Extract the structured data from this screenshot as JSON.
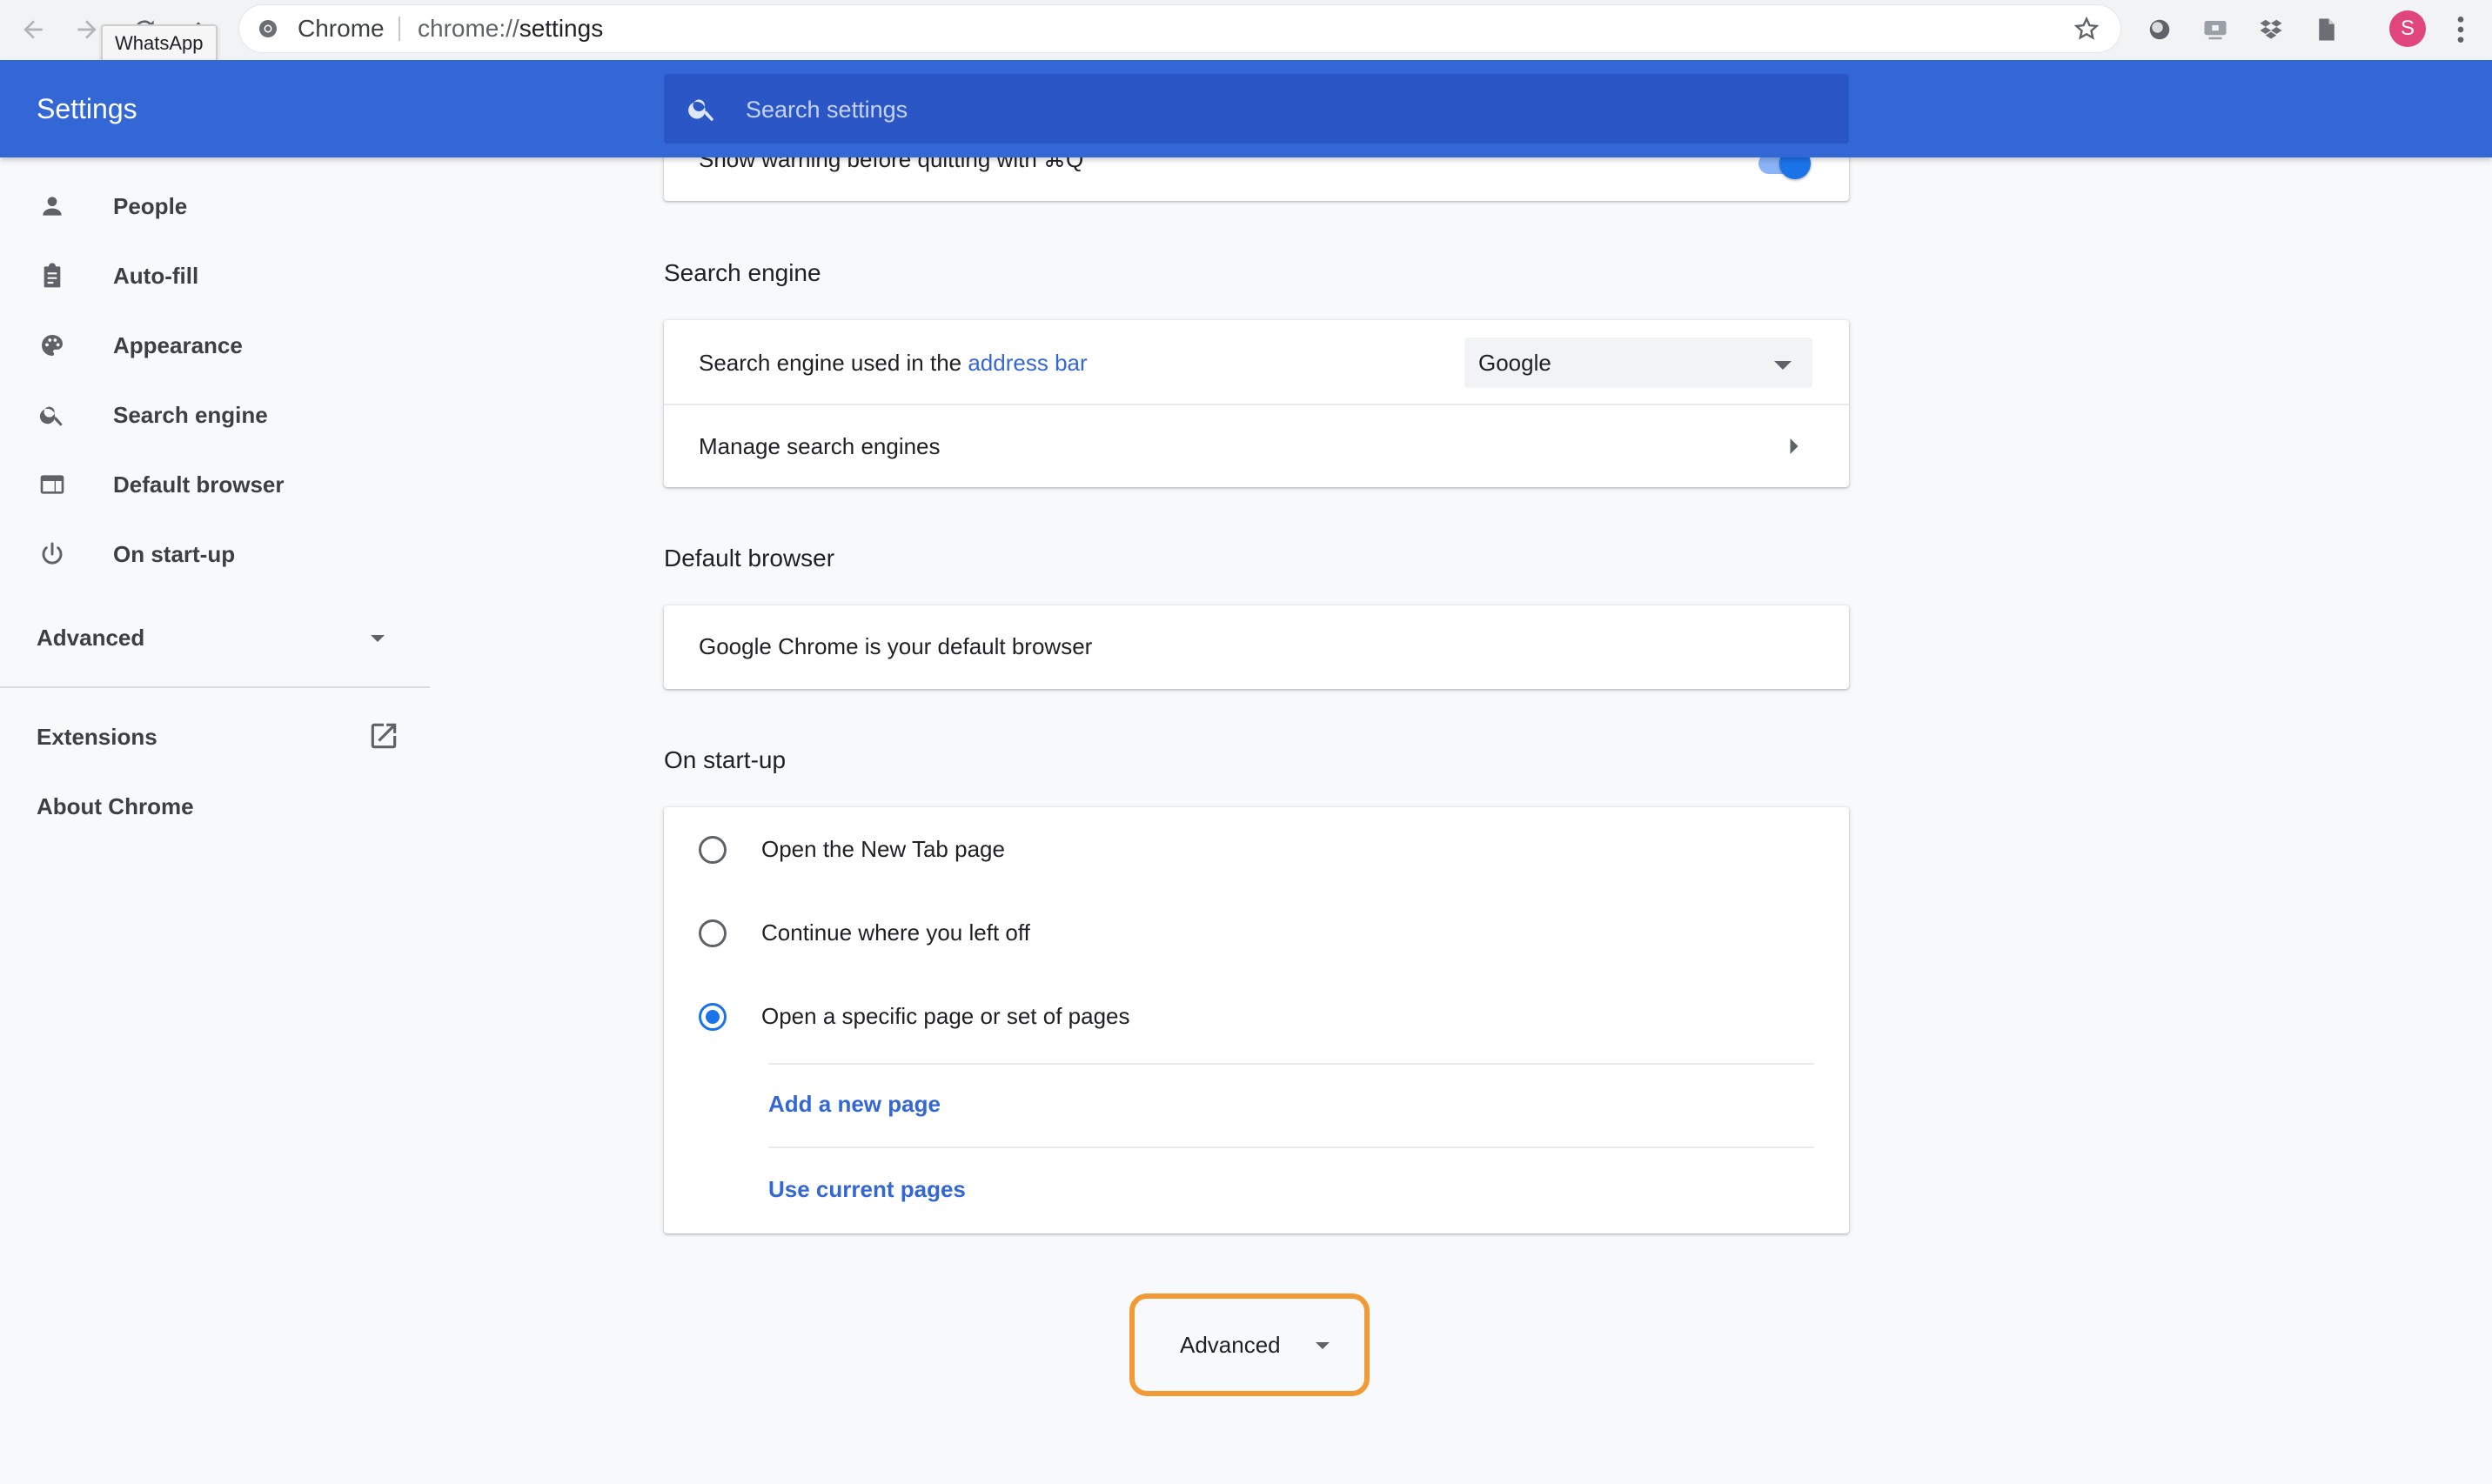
{
  "browser": {
    "tooltip": "WhatsApp",
    "site_chip": "Chrome",
    "url_prefix": "chrome://",
    "url_host": "settings",
    "avatar_letter": "S",
    "icons": [
      "back-arrow-icon",
      "forward-arrow-icon",
      "reload-icon",
      "apps-icon",
      "chrome-logo-icon",
      "star-icon",
      "extension-icon",
      "cast-icon",
      "dropbox-icon",
      "document-icon",
      "more-vert-icon"
    ]
  },
  "header": {
    "title": "Settings",
    "search_placeholder": "Search settings"
  },
  "sidebar": {
    "items": [
      {
        "label": "People",
        "icon": "person-icon"
      },
      {
        "label": "Auto-fill",
        "icon": "clipboard-icon"
      },
      {
        "label": "Appearance",
        "icon": "palette-icon"
      },
      {
        "label": "Search engine",
        "icon": "search-icon"
      },
      {
        "label": "Default browser",
        "icon": "browser-window-icon"
      },
      {
        "label": "On start-up",
        "icon": "power-icon"
      }
    ],
    "advanced_label": "Advanced",
    "extensions_label": "Extensions",
    "about_label": "About Chrome"
  },
  "main": {
    "partial_row_label": "Show warning before quitting with ⌘Q",
    "search_engine": {
      "title": "Search engine",
      "used_prefix": "Search engine used in the ",
      "used_link": "address bar",
      "selected": "Google",
      "manage_label": "Manage search engines"
    },
    "default_browser": {
      "title": "Default browser",
      "status": "Google Chrome is your default browser"
    },
    "startup": {
      "title": "On start-up",
      "options": [
        {
          "label": "Open the New Tab page",
          "selected": false
        },
        {
          "label": "Continue where you left off",
          "selected": false
        },
        {
          "label": "Open a specific page or set of pages",
          "selected": true
        }
      ],
      "add_page": "Add a new page",
      "use_current": "Use current pages"
    },
    "advanced_button": "Advanced"
  },
  "colors": {
    "header_blue": "#3367d6",
    "search_blue": "#2a56c6",
    "link_blue": "#3367d6",
    "highlight_orange": "#f29a36",
    "avatar_pink": "#e0457b"
  }
}
